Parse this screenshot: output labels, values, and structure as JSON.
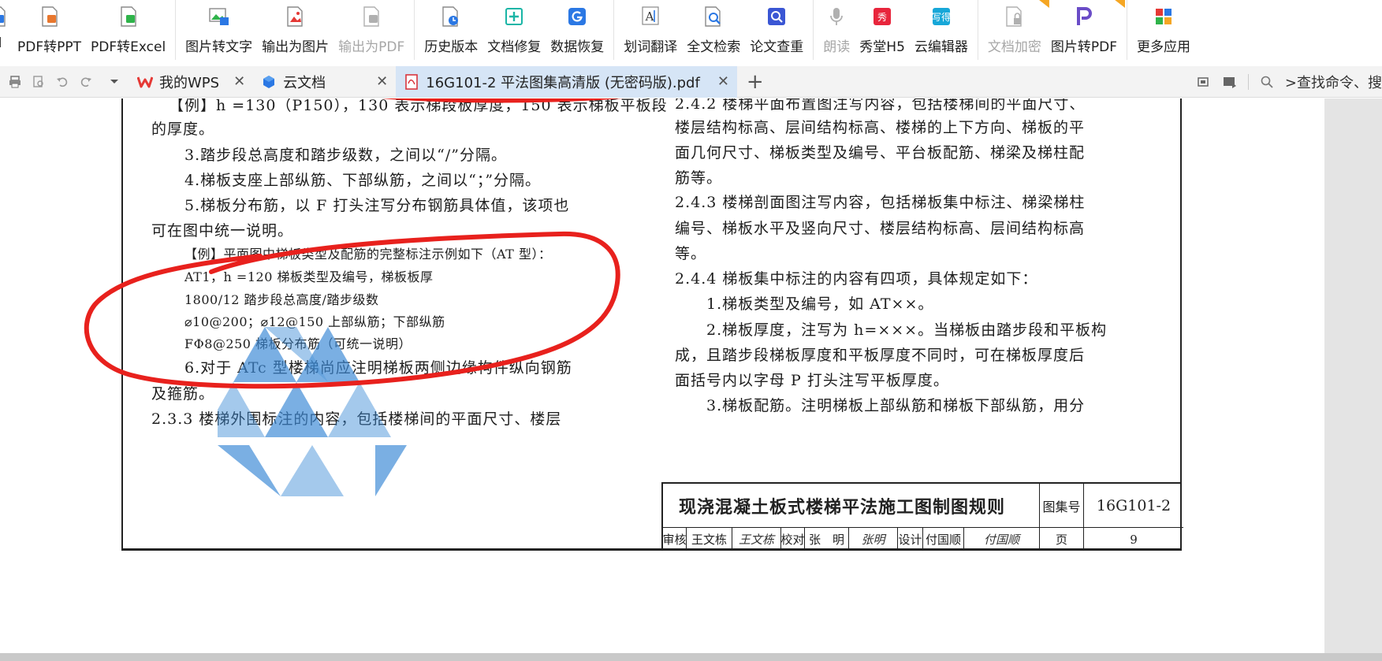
{
  "ribbon": {
    "groups": [
      [
        {
          "label": "d",
          "icon": "pdf-to-word-icon",
          "disabled": false
        },
        {
          "label": "PDF转PPT",
          "icon": "pdf-to-ppt-icon",
          "disabled": false
        },
        {
          "label": "PDF转Excel",
          "icon": "pdf-to-excel-icon",
          "disabled": false
        }
      ],
      [
        {
          "label": "图片转文字",
          "icon": "image-to-text-icon",
          "disabled": false
        },
        {
          "label": "输出为图片",
          "icon": "export-image-icon",
          "disabled": false
        },
        {
          "label": "输出为PDF",
          "icon": "export-pdf-icon",
          "disabled": true
        }
      ],
      [
        {
          "label": "历史版本",
          "icon": "history-icon",
          "disabled": false
        },
        {
          "label": "文档修复",
          "icon": "doc-repair-icon",
          "disabled": false
        },
        {
          "label": "数据恢复",
          "icon": "data-recovery-icon",
          "disabled": false
        }
      ],
      [
        {
          "label": "划词翻译",
          "icon": "translate-icon",
          "disabled": false
        },
        {
          "label": "全文检索",
          "icon": "fulltext-search-icon",
          "disabled": false
        },
        {
          "label": "论文查重",
          "icon": "paper-check-icon",
          "disabled": false
        }
      ],
      [
        {
          "label": "朗读",
          "icon": "read-aloud-icon",
          "disabled": true
        },
        {
          "label": "秀堂H5",
          "icon": "xiutang-h5-icon",
          "disabled": false
        },
        {
          "label": "云编辑器",
          "icon": "cloud-editor-icon",
          "disabled": false
        }
      ],
      [
        {
          "label": "文档加密",
          "icon": "doc-encrypt-icon",
          "disabled": true
        },
        {
          "label": "图片转PDF",
          "icon": "image-to-pdf-icon",
          "disabled": false
        }
      ],
      [
        {
          "label": "更多应用",
          "icon": "more-apps-icon",
          "disabled": false
        }
      ]
    ],
    "colors": {
      "blue": "#2b78e4",
      "green": "#2fb34a",
      "red": "#e53935",
      "purple": "#6a4cc7",
      "teal": "#19b5a6",
      "gray": "#b0b0b0"
    }
  },
  "tabs": [
    {
      "label": "我的WPS",
      "icon": "wps-logo-icon",
      "active": false
    },
    {
      "label": "云文档",
      "icon": "cloud-doc-icon",
      "active": false
    },
    {
      "label": "16G101-2 平法图集高清版 (无密码版).pdf",
      "icon": "pdf-file-icon",
      "active": true
    }
  ],
  "command_search": ">查找命令、搜",
  "document": {
    "left_lines": [
      "【例】h =130（P150），130 表示梯段板厚度，150 表示梯板平板段",
      "的厚度。",
      "3.踏步段总高度和踏步级数，之间以“/”分隔。",
      "4.梯板支座上部纵筋、下部纵筋，之间以“；”分隔。",
      "5.梯板分布筋，以 F 打头注写分布钢筋具体值，该项也",
      "可在图中统一说明。",
      "【例】平面图中梯板类型及配筋的完整标注示例如下（AT 型）：",
      "AT1，h =120   梯板类型及编号，梯板板厚",
      "1800/12   踏步段总高度/踏步级数",
      "⌀10@200；⌀12@150   上部纵筋；下部纵筋",
      "FΦ8@250   梯板分布筋（可统一说明）",
      "6.对于 ATc 型楼梯尚应注明梯板两侧边缘构件纵向钢筋",
      "及箍筋。",
      "2.3.3 楼梯外围标注的内容，包括楼梯间的平面尺寸、楼层"
    ],
    "right_lines": [
      "2.4.2 楼梯平面布置图注写内容，包括楼梯间的平面尺寸、",
      "楼层结构标高、层间结构标高、楼梯的上下方向、梯板的平",
      "面几何尺寸、梯板类型及编号、平台板配筋、梯梁及梯柱配",
      "筋等。",
      "2.4.3 楼梯剖面图注写内容，包括梯板集中标注、梯梁梯柱",
      "编号、梯板水平及竖向尺寸、楼层结构标高、层间结构标高",
      "等。",
      "2.4.4 梯板集中标注的内容有四项，具体规定如下：",
      "1.梯板类型及编号，如 AT××。",
      "2.梯板厚度，注写为 h=×××。当梯板由踏步段和平板构",
      "成，且踏步段梯板厚度和平板厚度不同时，可在梯板厚度后",
      "面括号内以字母 P 打头注写平板厚度。",
      "3.梯板配筋。注明梯板上部纵筋和梯板下部纵筋，用分"
    ],
    "title_block": {
      "title": "现浇混凝土板式楼梯平法施工图制图规则",
      "atlas_label": "图集号",
      "atlas_code": "16G101-2",
      "review_label": "审核",
      "review_name": "王文栋",
      "review_sig": "王文栋",
      "check_label": "校对",
      "check_name": "张　明",
      "check_sig": "张明",
      "design_label": "设计",
      "design_name": "付国顺",
      "design_sig": "付国顺",
      "page_label": "页",
      "page_number": "9"
    },
    "annotation_color": "#e8211d",
    "watermark_color": "#3c8ad6"
  }
}
